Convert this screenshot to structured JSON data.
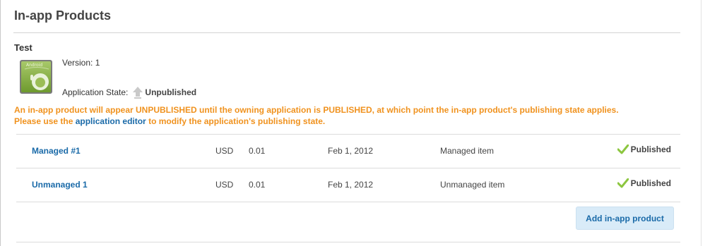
{
  "page": {
    "title": "In-app Products"
  },
  "app": {
    "name": "Test",
    "icon_label": "Android",
    "version_label": "Version:",
    "version_value": "1",
    "state_label": "Application State:",
    "state_value": "Unpublished"
  },
  "notice": {
    "line1": "An in-app product will appear UNPUBLISHED until the owning application is PUBLISHED, at which point the in-app product's publishing state applies.",
    "line2_before": "Please use the ",
    "line2_link": "application editor",
    "line2_after": " to modify the application's publishing state.",
    "color": "#f0921e"
  },
  "products": [
    {
      "name": "Managed #1",
      "currency": "USD",
      "price": "0.01",
      "date": "Feb 1, 2012",
      "type": "Managed item",
      "status": "Published"
    },
    {
      "name": "Unmanaged 1",
      "currency": "USD",
      "price": "0.01",
      "date": "Feb 1, 2012",
      "type": "Unmanaged item",
      "status": "Published"
    }
  ],
  "actions": {
    "add_label": "Add in-app product"
  },
  "colors": {
    "link": "#1a6aa8",
    "check": "#8cc63f",
    "button_bg": "#d9ebf8"
  }
}
